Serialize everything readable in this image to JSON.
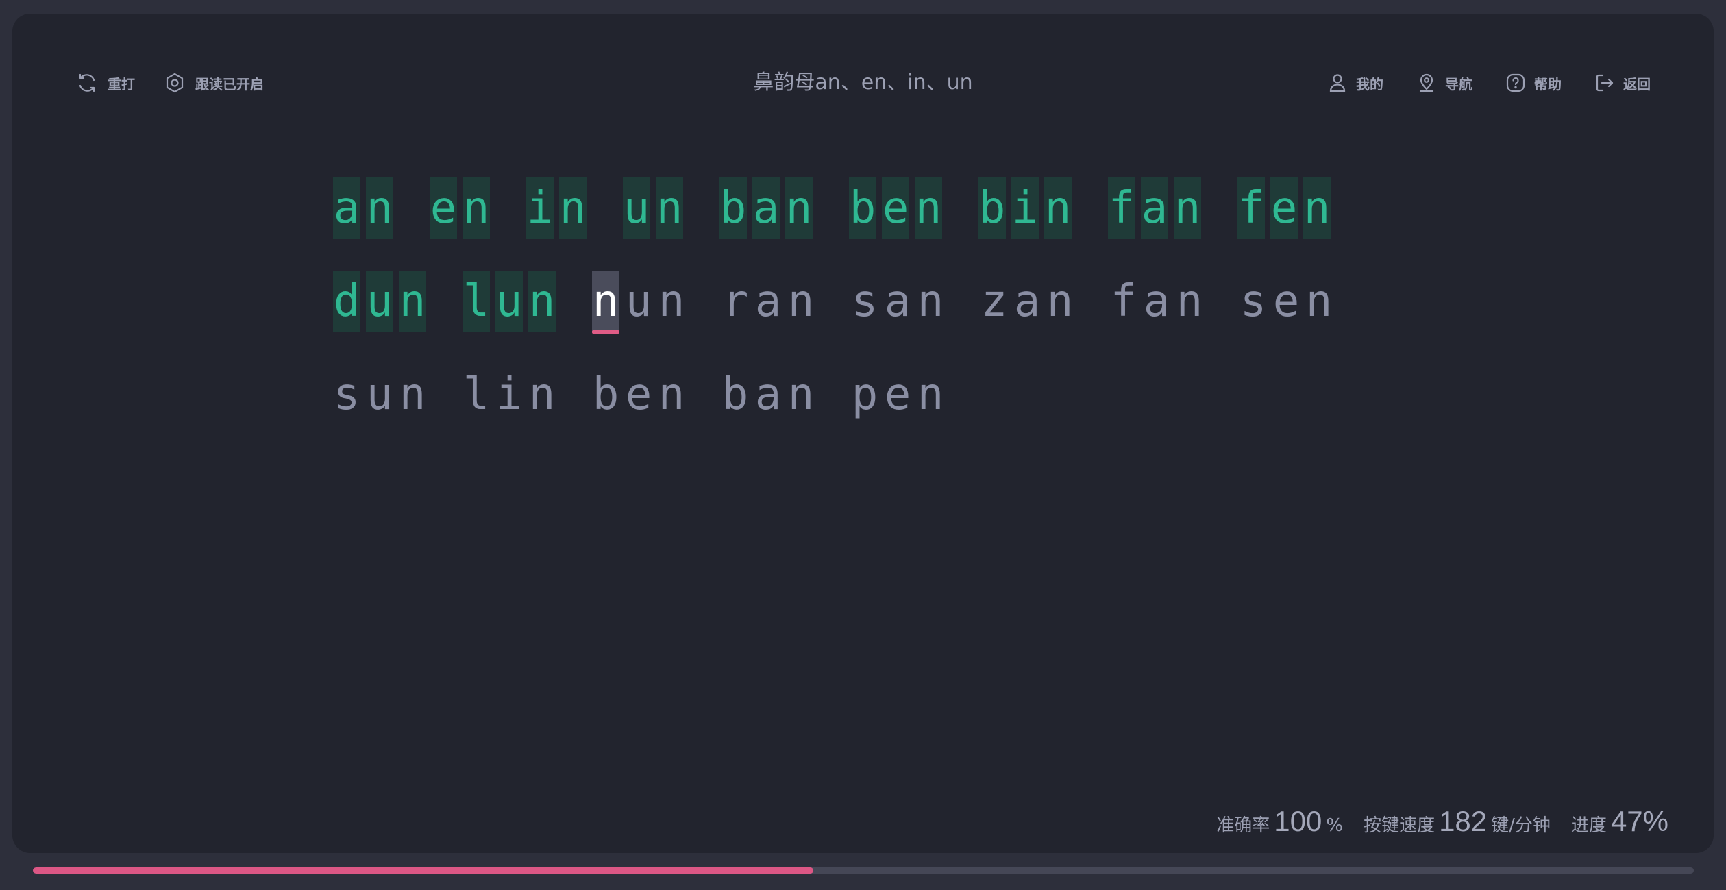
{
  "header": {
    "title": "鼻韵母an、en、in、un",
    "left_tools": [
      {
        "label": "重打",
        "icon": "refresh-icon"
      },
      {
        "label": "跟读已开启",
        "icon": "settings-hex-icon"
      }
    ],
    "right_tools": [
      {
        "label": "我的",
        "icon": "user-icon"
      },
      {
        "label": "导航",
        "icon": "location-pin-icon"
      },
      {
        "label": "帮助",
        "icon": "help-icon"
      },
      {
        "label": "返回",
        "icon": "logout-icon"
      }
    ]
  },
  "typing": {
    "lines": [
      [
        "an",
        "en",
        "in",
        "un",
        "ban",
        "ben",
        "bin",
        "fan",
        "fen"
      ],
      [
        "dun",
        "lun",
        "nun",
        "ran",
        "san",
        "zan",
        "fan",
        "sen"
      ],
      [
        "sun",
        "lin",
        "ben",
        "ban",
        "pen"
      ]
    ],
    "cursor": {
      "line": 1,
      "word": 2,
      "char": 0
    }
  },
  "stats": {
    "accuracy_label": "准确率",
    "accuracy_value": "100",
    "accuracy_unit": "%",
    "speed_label": "按键速度",
    "speed_value": "182",
    "speed_unit": "键/分钟",
    "progress_label": "进度",
    "progress_value": "47%"
  },
  "progress": {
    "fraction": 0.47
  },
  "colors": {
    "background": "#2d2f3b",
    "card": "#22242e",
    "correct_text": "#2fb892",
    "correct_bg": "#1f3b38",
    "pending_text": "#8a8ea3",
    "cursor_bg": "#4a4c5b",
    "accent": "#dc5785"
  }
}
